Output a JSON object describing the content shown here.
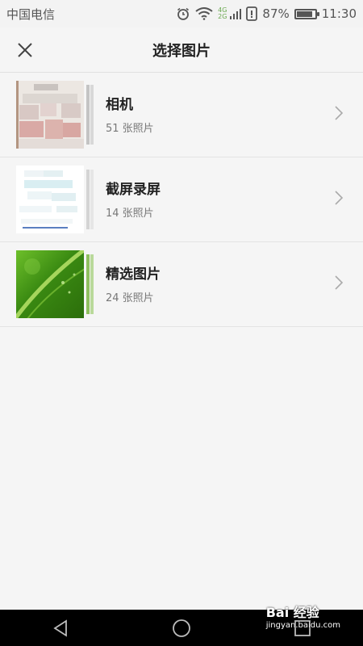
{
  "status_bar": {
    "carrier": "中国电信",
    "net_top": "4G",
    "net_bottom": "2G",
    "battery": "87%",
    "battery_level": 0.87,
    "time": "11:30"
  },
  "header": {
    "title": "选择图片"
  },
  "albums": [
    {
      "name": "相机",
      "count": "51 张照片"
    },
    {
      "name": "截屏录屏",
      "count": "14 张照片"
    },
    {
      "name": "精选图片",
      "count": "24 张照片"
    }
  ],
  "watermark": {
    "brand": "Bai 经验",
    "url": "jingyan.baidu.com"
  },
  "colors": {
    "background": "#f5f5f5",
    "divider": "#e3e3e3",
    "nav_bar": "#000000",
    "net_badge": "#6aa84f"
  }
}
